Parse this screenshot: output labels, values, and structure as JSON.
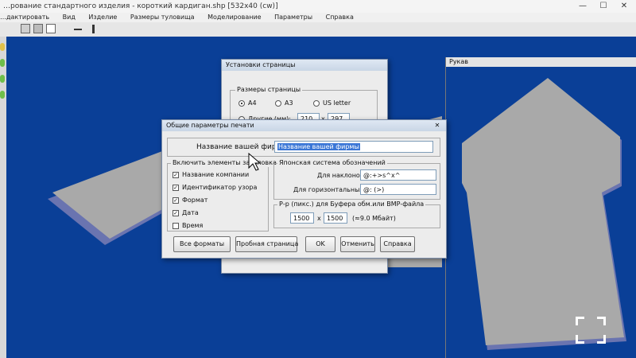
{
  "window": {
    "title": "…рование стандартного изделия - короткий кардиган.shp  [532x40  (cw)]",
    "min": "—",
    "max": "☐",
    "close": "✕"
  },
  "menu": [
    "…дактировать",
    "Вид",
    "Изделие",
    "Размеры туловища",
    "Моделирование",
    "Параметры",
    "Справка"
  ],
  "sleeve_panel": {
    "title": "Рукав"
  },
  "page_setup_dialog": {
    "title": "Установки страницы",
    "group_label": "Размеры страницы",
    "options": [
      {
        "label": "A4",
        "selected": true
      },
      {
        "label": "A3",
        "selected": false
      },
      {
        "label": "US letter",
        "selected": false
      },
      {
        "label": "Другие (мм):",
        "selected": false
      }
    ],
    "width_value": "210",
    "height_value": "297",
    "x_sep": "x"
  },
  "print_dialog": {
    "title": "Общие параметры печати",
    "company_label": "Название вашей фирмы",
    "company_value": "Название вашей фирмы",
    "include_group_label": "Включить элементы заголовка",
    "include_items": [
      {
        "label": "Название компании",
        "checked": true
      },
      {
        "label": "Идентификатор узора",
        "checked": true
      },
      {
        "label": "Формат",
        "checked": true
      },
      {
        "label": "Дата",
        "checked": true
      },
      {
        "label": "Время",
        "checked": false
      }
    ],
    "japanese_group_label": "Японская система обозначений",
    "slopes_label": "Для наклонов",
    "slopes_value": "@:+>s^x^",
    "horizontal_label": "Для горизонтальных краев",
    "horizontal_value": "@: (>)",
    "buffer_group_label": "Р-р (пикс.) для Буфера обм.или BMP-файла",
    "buffer_width": "1500",
    "buffer_x": "x",
    "buffer_height": "1500",
    "buffer_info": "(≈9.0 Мбайт)",
    "buttons": {
      "all_formats": "Все форматы",
      "test_page": "Пробная страница",
      "ok": "OK",
      "cancel": "Отменить",
      "help": "Справка"
    }
  },
  "colors": {
    "canvas": "#0a3f97",
    "garment": "#a9a9a9",
    "garment_shadow": "#6a74b0",
    "selection": "#3a76d6"
  }
}
